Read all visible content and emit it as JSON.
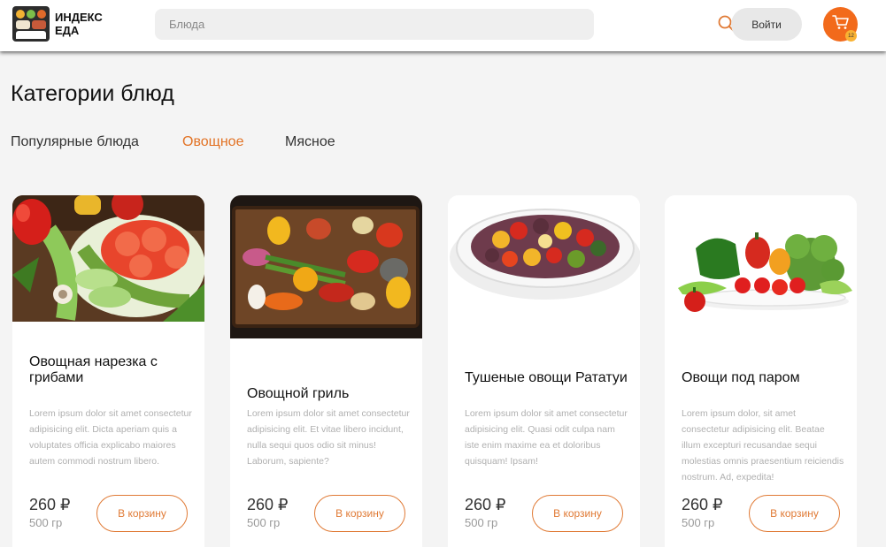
{
  "header": {
    "logo_line1": "ИНДЕКС",
    "logo_line2": "ЕДА",
    "search_placeholder": "Блюда",
    "login_label": "Войти",
    "cart_count": "12",
    "accent_color": "#f26a1b"
  },
  "main": {
    "title": "Категории блюд",
    "tabs": [
      {
        "label": "Популярные блюда",
        "active": false
      },
      {
        "label": "Овощное",
        "active": true
      },
      {
        "label": "Мясное",
        "active": false
      }
    ]
  },
  "cards": [
    {
      "title": "Овощная нарезка с грибами",
      "description": "Lorem ipsum dolor sit amet consectetur adipisicing elit. Dicta aperiam quis a voluptates officia explicabo maiores autem commodi nostrum libero.",
      "price": "260 ₽",
      "weight": "500 гр",
      "button_label": "В корзину"
    },
    {
      "title": "Овощной гриль",
      "description": "Lorem ipsum dolor sit amet consectetur adipisicing elit. Et vitae libero incidunt, nulla sequi quos odio sit minus! Laborum, sapiente?",
      "price": "260 ₽",
      "weight": "500 гр",
      "button_label": "В корзину"
    },
    {
      "title": "Тушеные овощи Рататуи",
      "description": "Lorem ipsum dolor sit amet consectetur adipisicing elit. Quasi odit culpa nam iste enim maxime ea et doloribus quisquam! Ipsam!",
      "price": "260 ₽",
      "weight": "500 гр",
      "button_label": "В корзину"
    },
    {
      "title": "Овощи под паром",
      "description": "Lorem ipsum dolor, sit amet consectetur adipisicing elit. Beatae illum excepturi recusandae sequi molestias omnis praesentium reiciendis nostrum. Ad, expedita!",
      "price": "260 ₽",
      "weight": "500 гр",
      "button_label": "В корзину"
    }
  ]
}
